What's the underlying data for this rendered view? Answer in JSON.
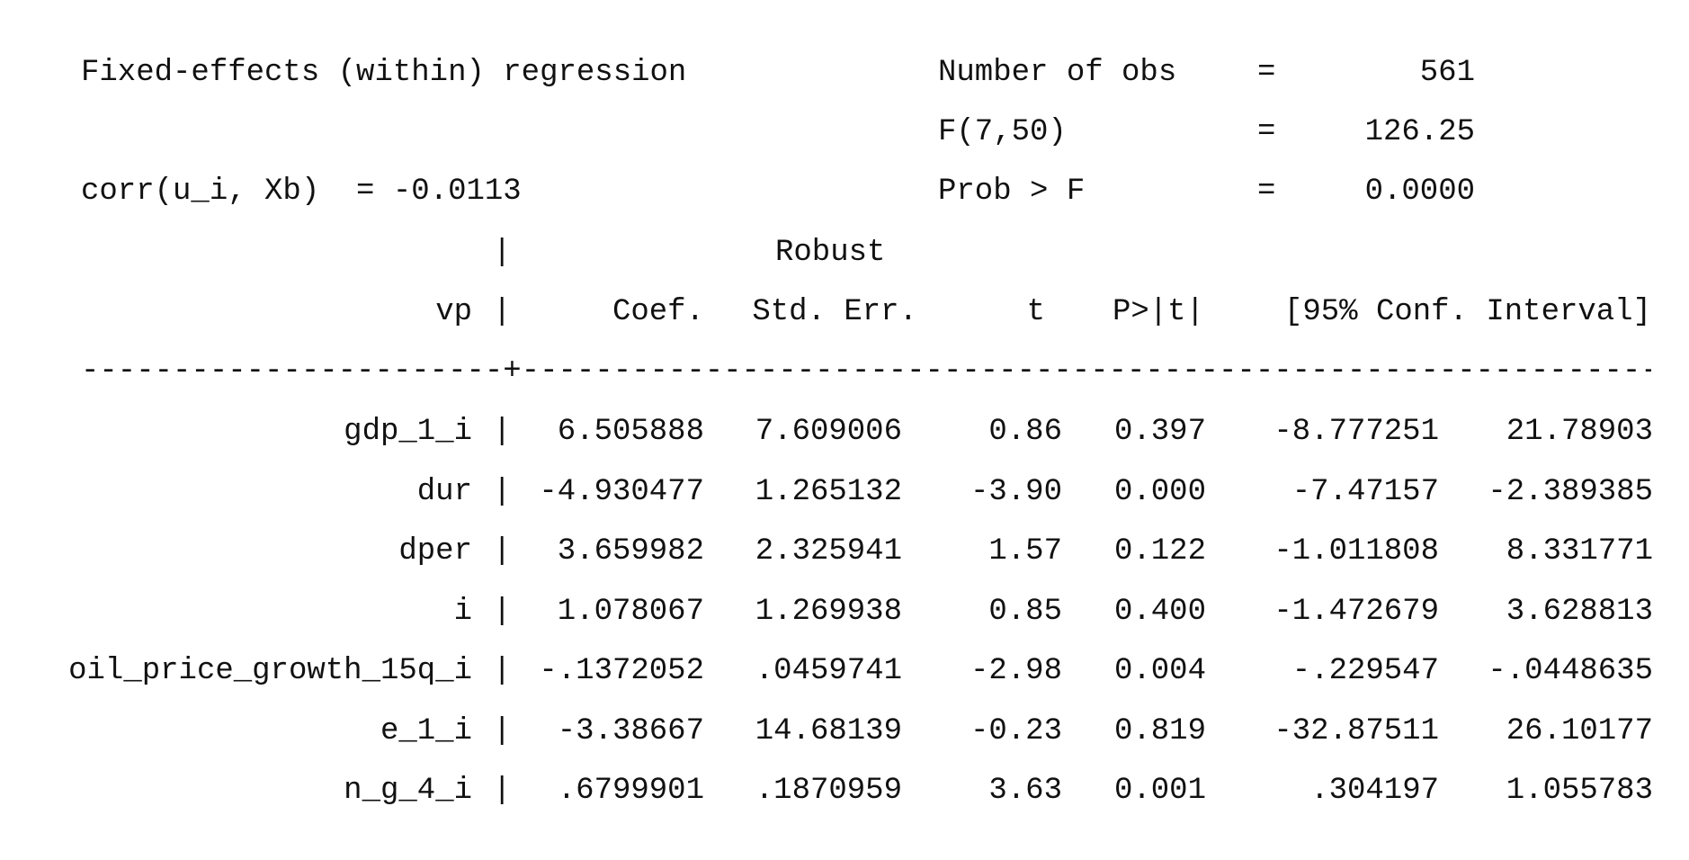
{
  "header": {
    "title": "Fixed-effects (within) regression",
    "corr_label": "corr(u_i, Xb)  = -0.0113",
    "stats": [
      {
        "label": "Number of obs",
        "eq": "=",
        "value": "561"
      },
      {
        "label": "F(7,50)",
        "eq": "=",
        "value": "126.25"
      },
      {
        "label": "Prob > F",
        "eq": "=",
        "value": "0.0000"
      }
    ]
  },
  "table": {
    "robust_label": "Robust",
    "depvar": "vp",
    "columns": [
      "Coef.",
      "Std. Err.",
      "t",
      "P>|t|",
      "[95% Conf. Interval]"
    ],
    "pipe": "|",
    "separator_left": "-----------------------",
    "separator_plus": "+",
    "separator_right": "------------------------------------------------------------------",
    "rows": [
      {
        "var": "gdp_1_i",
        "coef": "6.505888",
        "se": "7.609006",
        "t": "0.86",
        "p": "0.397",
        "lo": "-8.777251",
        "hi": "21.78903"
      },
      {
        "var": "dur",
        "coef": "-4.930477",
        "se": "1.265132",
        "t": "-3.90",
        "p": "0.000",
        "lo": "-7.47157",
        "hi": "-2.389385"
      },
      {
        "var": "dper",
        "coef": "3.659982",
        "se": "2.325941",
        "t": "1.57",
        "p": "0.122",
        "lo": "-1.011808",
        "hi": "8.331771"
      },
      {
        "var": "i",
        "coef": "1.078067",
        "se": "1.269938",
        "t": "0.85",
        "p": "0.400",
        "lo": "-1.472679",
        "hi": "3.628813"
      },
      {
        "var": "oil_price_growth_15q_i",
        "coef": "-.1372052",
        "se": ".0459741",
        "t": "-2.98",
        "p": "0.004",
        "lo": "-.229547",
        "hi": "-.0448635"
      },
      {
        "var": "e_1_i",
        "coef": "-3.38667",
        "se": "14.68139",
        "t": "-0.23",
        "p": "0.819",
        "lo": "-32.87511",
        "hi": "26.10177"
      },
      {
        "var": "n_g_4_i",
        "coef": ".6799901",
        "se": ".1870959",
        "t": "3.63",
        "p": "0.001",
        "lo": ".304197",
        "hi": "1.055783"
      }
    ]
  }
}
